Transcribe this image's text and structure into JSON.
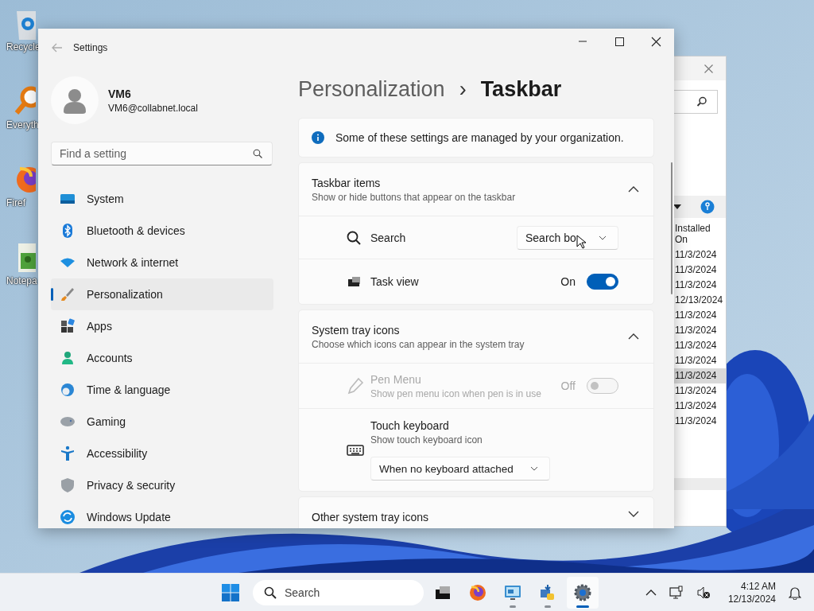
{
  "desktop_icons": [
    {
      "kind": "recycle",
      "label": "Recycle"
    },
    {
      "kind": "magnifier",
      "label": "Everyth"
    },
    {
      "kind": "browser",
      "label": "Firef"
    },
    {
      "kind": "notepad",
      "label": "Notepa"
    }
  ],
  "background_window": {
    "column": "Installed On",
    "rows": [
      {
        "installed_on": "11/3/2024",
        "selected": false
      },
      {
        "installed_on": "11/3/2024",
        "selected": false
      },
      {
        "installed_on": "11/3/2024",
        "selected": false
      },
      {
        "installed_on": "12/13/2024",
        "selected": false
      },
      {
        "installed_on": "11/3/2024",
        "selected": false
      },
      {
        "installed_on": "11/3/2024",
        "selected": false
      },
      {
        "installed_on": "11/3/2024",
        "selected": false
      },
      {
        "installed_on": "11/3/2024",
        "selected": false
      },
      {
        "installed_on": "11/3/2024",
        "selected": true
      },
      {
        "installed_on": "11/3/2024",
        "selected": false
      },
      {
        "installed_on": "11/3/2024",
        "selected": false
      },
      {
        "installed_on": "11/3/2024",
        "selected": false
      }
    ]
  },
  "settings": {
    "title": "Settings",
    "user": {
      "name": "VM6",
      "email": "VM6@collabnet.local"
    },
    "search": {
      "placeholder": "Find a setting"
    },
    "nav": [
      {
        "kind": "system",
        "label": "System",
        "selected": false
      },
      {
        "kind": "bluetooth",
        "label": "Bluetooth & devices",
        "selected": false
      },
      {
        "kind": "network",
        "label": "Network & internet",
        "selected": false
      },
      {
        "kind": "personalization",
        "label": "Personalization",
        "selected": true
      },
      {
        "kind": "apps",
        "label": "Apps",
        "selected": false
      },
      {
        "kind": "accounts",
        "label": "Accounts",
        "selected": false
      },
      {
        "kind": "time",
        "label": "Time & language",
        "selected": false
      },
      {
        "kind": "gaming",
        "label": "Gaming",
        "selected": false
      },
      {
        "kind": "accessibility",
        "label": "Accessibility",
        "selected": false
      },
      {
        "kind": "privacy",
        "label": "Privacy & security",
        "selected": false
      },
      {
        "kind": "update",
        "label": "Windows Update",
        "selected": false
      }
    ],
    "breadcrumb": {
      "parent": "Personalization",
      "separator": "›",
      "current": "Taskbar"
    },
    "notice": "Some of these settings are managed by your organization.",
    "sections": [
      {
        "title": "Taskbar items",
        "subtitle": "Show or hide buttons that appear on the taskbar",
        "expanded": true,
        "rows": [
          {
            "kind": "dropdown",
            "label": "Search",
            "value": "Search bo",
            "disabled": false
          },
          {
            "kind": "toggle",
            "label": "Task view",
            "value": "On",
            "on": true,
            "disabled": false
          }
        ]
      },
      {
        "title": "System tray icons",
        "subtitle": "Choose which icons can appear in the system tray",
        "expanded": true,
        "rows": [
          {
            "kind": "toggle",
            "label": "Pen Menu",
            "subtitle": "Show pen menu icon when pen is in use",
            "value": "Off",
            "on": false,
            "disabled": true
          },
          {
            "kind": "select",
            "label": "Touch keyboard",
            "subtitle": "Show touch keyboard icon",
            "value": "When no keyboard attached",
            "disabled": false
          }
        ]
      },
      {
        "title": "Other system tray icons",
        "expanded": false
      }
    ]
  },
  "taskbar": {
    "search_placeholder": "Search",
    "apps": [
      {
        "kind": "taskview",
        "open": false,
        "selected": false
      },
      {
        "kind": "browser",
        "open": false,
        "selected": false
      },
      {
        "kind": "monitor",
        "open": true,
        "selected": false
      },
      {
        "kind": "installer",
        "open": true,
        "selected": false
      },
      {
        "kind": "settings",
        "open": true,
        "selected": true
      }
    ],
    "time": "4:12 AM",
    "date": "12/13/2024"
  }
}
